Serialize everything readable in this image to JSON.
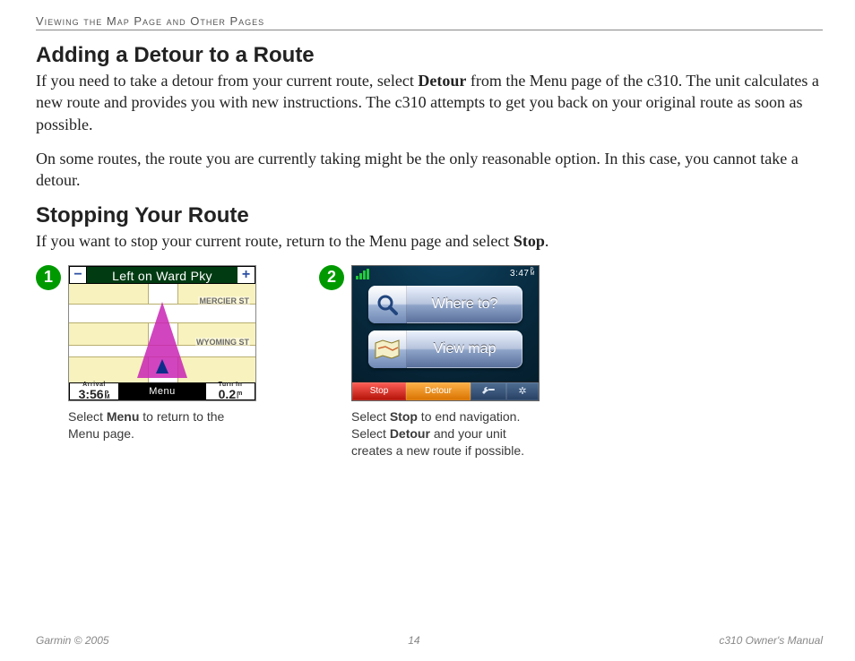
{
  "runningHead": "Viewing the Map Page and Other Pages",
  "h1": "Adding a Detour to a Route",
  "p1a": "If you need to take a detour from your current route, select ",
  "p1b": "Detour",
  "p1c": " from the Menu page of the c310. The unit calculates a new route and provides you with new instructions. The c310 attempts to get you back on your original route as soon as possible.",
  "p2": "On some routes, the route you are currently taking might be the only reasonable option. In this case, you cannot take a detour.",
  "h2": "Stopping Your Route",
  "p3a": "If you want to stop your current route, return to the Menu page and select ",
  "p3b": "Stop",
  "p3c": ".",
  "fig1": {
    "num": "1",
    "topTitle": "Left on Ward Pky",
    "zoomMinus": "−",
    "zoomPlus": "+",
    "street1": "MERCIER ST",
    "street2": "WYOMING ST",
    "arrivalK": "Arrival",
    "arrivalV": "3:56",
    "arrivalU": "P\nM",
    "menu": "Menu",
    "turnK": "Turn In",
    "turnV": "0.2",
    "turnU": "m\ni",
    "capA": "Select ",
    "capB": "Menu",
    "capC": " to return to the Menu page."
  },
  "fig2": {
    "num": "2",
    "clock": "3:47",
    "clockU": "P\nM",
    "btnWhere": "Where to?",
    "btnView": "View map",
    "stop": "Stop",
    "detour": "Detour",
    "capA": "Select ",
    "capB": "Stop",
    "capC": " to end navigation. Select ",
    "capD": "Detour",
    "capE": " and your unit creates a new route if possible."
  },
  "footer": {
    "left": "Garmin © 2005",
    "center": "14",
    "right": "c310 Owner's Manual"
  }
}
